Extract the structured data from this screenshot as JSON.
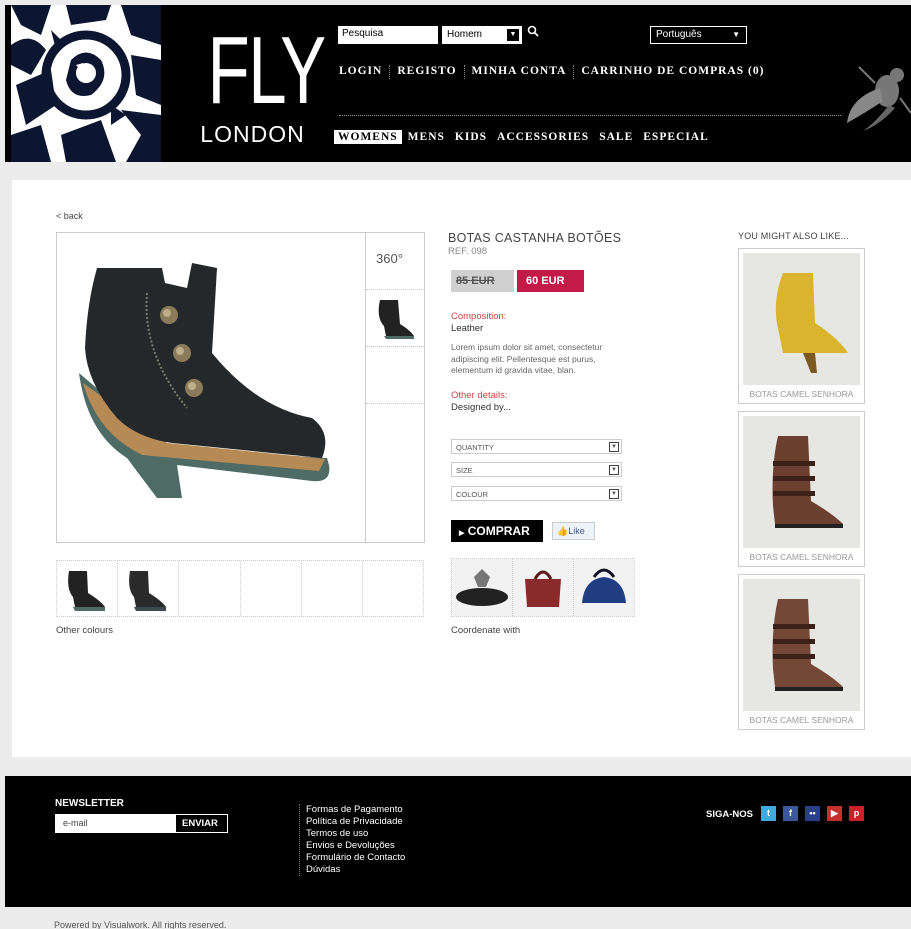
{
  "header": {
    "brand_fly": "FLY",
    "brand_london": "LONDON",
    "search_placeholder": "Pesquisa",
    "gender_value": "Homem",
    "language_value": "Português",
    "top_links": [
      "LOGIN",
      "REGISTO",
      "MINHA CONTA",
      "CARRINHO DE COMPRAS (0)"
    ],
    "nav": [
      "WOMENS",
      "MENS",
      "KIDS",
      "ACCESSORIES",
      "SALE",
      "ESPECIAL"
    ]
  },
  "product": {
    "back_label": "< back",
    "title": "BOTAS CASTANHA BOTÕES",
    "ref": "REF. 098",
    "old_price": "85 EUR",
    "new_price": "60 EUR",
    "composition_label": "Composition:",
    "composition_value": "Leather",
    "description": "Lorem ipsum dolor sit amet, consectetur adipiscing elit. Pellentesque est purus, elementum id gravida vitae, blan.",
    "other_details_label": "Other details:",
    "other_details_value": "Designed by...",
    "view_360_label": "360°",
    "options": [
      "QUANTITY",
      "SIZE",
      "COLOUR"
    ],
    "buy_label": "COMPRAR",
    "like_label": "Like",
    "other_colours_label": "Other colours",
    "coordinate_label": "Coordenate with"
  },
  "recommendations": {
    "title": "YOU MIGHT ALSO LIKE...",
    "items": [
      {
        "name": "BOTAS CAMEL SENHORA"
      },
      {
        "name": "BOTAS CAMEL SENHORA"
      },
      {
        "name": "BOTAS CAMEL SENHORA"
      }
    ]
  },
  "footer": {
    "newsletter_title": "NEWSLETTER",
    "email_placeholder": "e-mail",
    "send_label": "ENVIAR",
    "links": [
      "Formas de Pagamento",
      "Política de Privacidade",
      "Termos de uso",
      "Envios e Devoluções",
      "Formulário de Contacto",
      "Dúvidas"
    ],
    "follow_label": "SIGA-NOS",
    "social_icons": [
      "twitter-icon",
      "facebook-icon",
      "flickr-icon",
      "youtube-icon",
      "pinterest-icon"
    ],
    "powered": "Powered by Visualwork. All rights reserved."
  },
  "colors": {
    "accent_price": "#c41a48",
    "detail_heading": "#cc4444"
  }
}
